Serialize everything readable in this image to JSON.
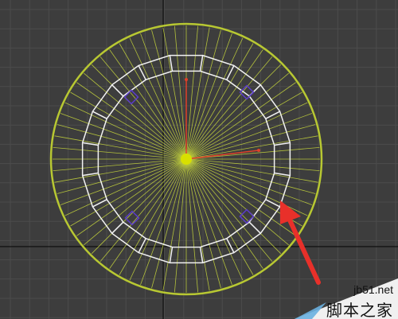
{
  "viewport": {
    "view": "Top",
    "colors": {
      "background": "#3d3d3d",
      "grid": "#4c4c4c",
      "axis": "#101010",
      "outer_selection_ring": "#b8c832",
      "radial_spokes": "#c8d83c",
      "inner_wireframe": "#f2f2f2",
      "gizmo_x": "#e0402a",
      "gizmo_y": "#e0402a",
      "gizmo_center": "#d8e000",
      "vertex_markers": "#5a3cc8",
      "arrow": "#e8302a"
    },
    "objects": [
      {
        "name": "outer-ring",
        "type": "circle",
        "selected": true
      },
      {
        "name": "inner-polygon-band",
        "type": "polygon",
        "sides": 20
      },
      {
        "name": "radial-spokes",
        "count": 72
      },
      {
        "name": "move-gizmo",
        "type": "transform-gizmo"
      },
      {
        "name": "vertex-markers",
        "count": 4
      }
    ],
    "annotation": {
      "type": "arrow",
      "icon": "red-arrow-icon"
    }
  },
  "watermark": {
    "url": "jb51.net",
    "name": "脚本之家",
    "icon": "jb51-logo-icon"
  }
}
